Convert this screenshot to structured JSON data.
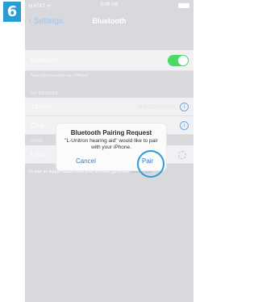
{
  "step": "6",
  "statusbar": {
    "carrier": "•ıl AT&T ᯤ",
    "time": "9:09 AM"
  },
  "nav": {
    "back": "Settings",
    "title": "Bluetooth"
  },
  "bluetooth": {
    "label": "Bluetooth",
    "discoverable": "Now discoverable as \"iPhone\"."
  },
  "my_devices": {
    "header": "MY DEVICES",
    "items": [
      {
        "name": "14AHU",
        "status": "Not Connected"
      },
      {
        "name": "Char",
        "status": ""
      }
    ]
  },
  "other_devices": {
    "header": "OTHE",
    "items": [
      {
        "name": "L-Un"
      }
    ]
  },
  "footer": {
    "text": "To pair an Apple Watch with your iPhone, go to the",
    "link": "Watch app."
  },
  "dialog": {
    "title": "Bluetooth Pairing Request",
    "message": "\"L-Unitron hearing aid\" would like to pair with your iPhone.",
    "cancel": "Cancel",
    "pair": "Pair"
  }
}
